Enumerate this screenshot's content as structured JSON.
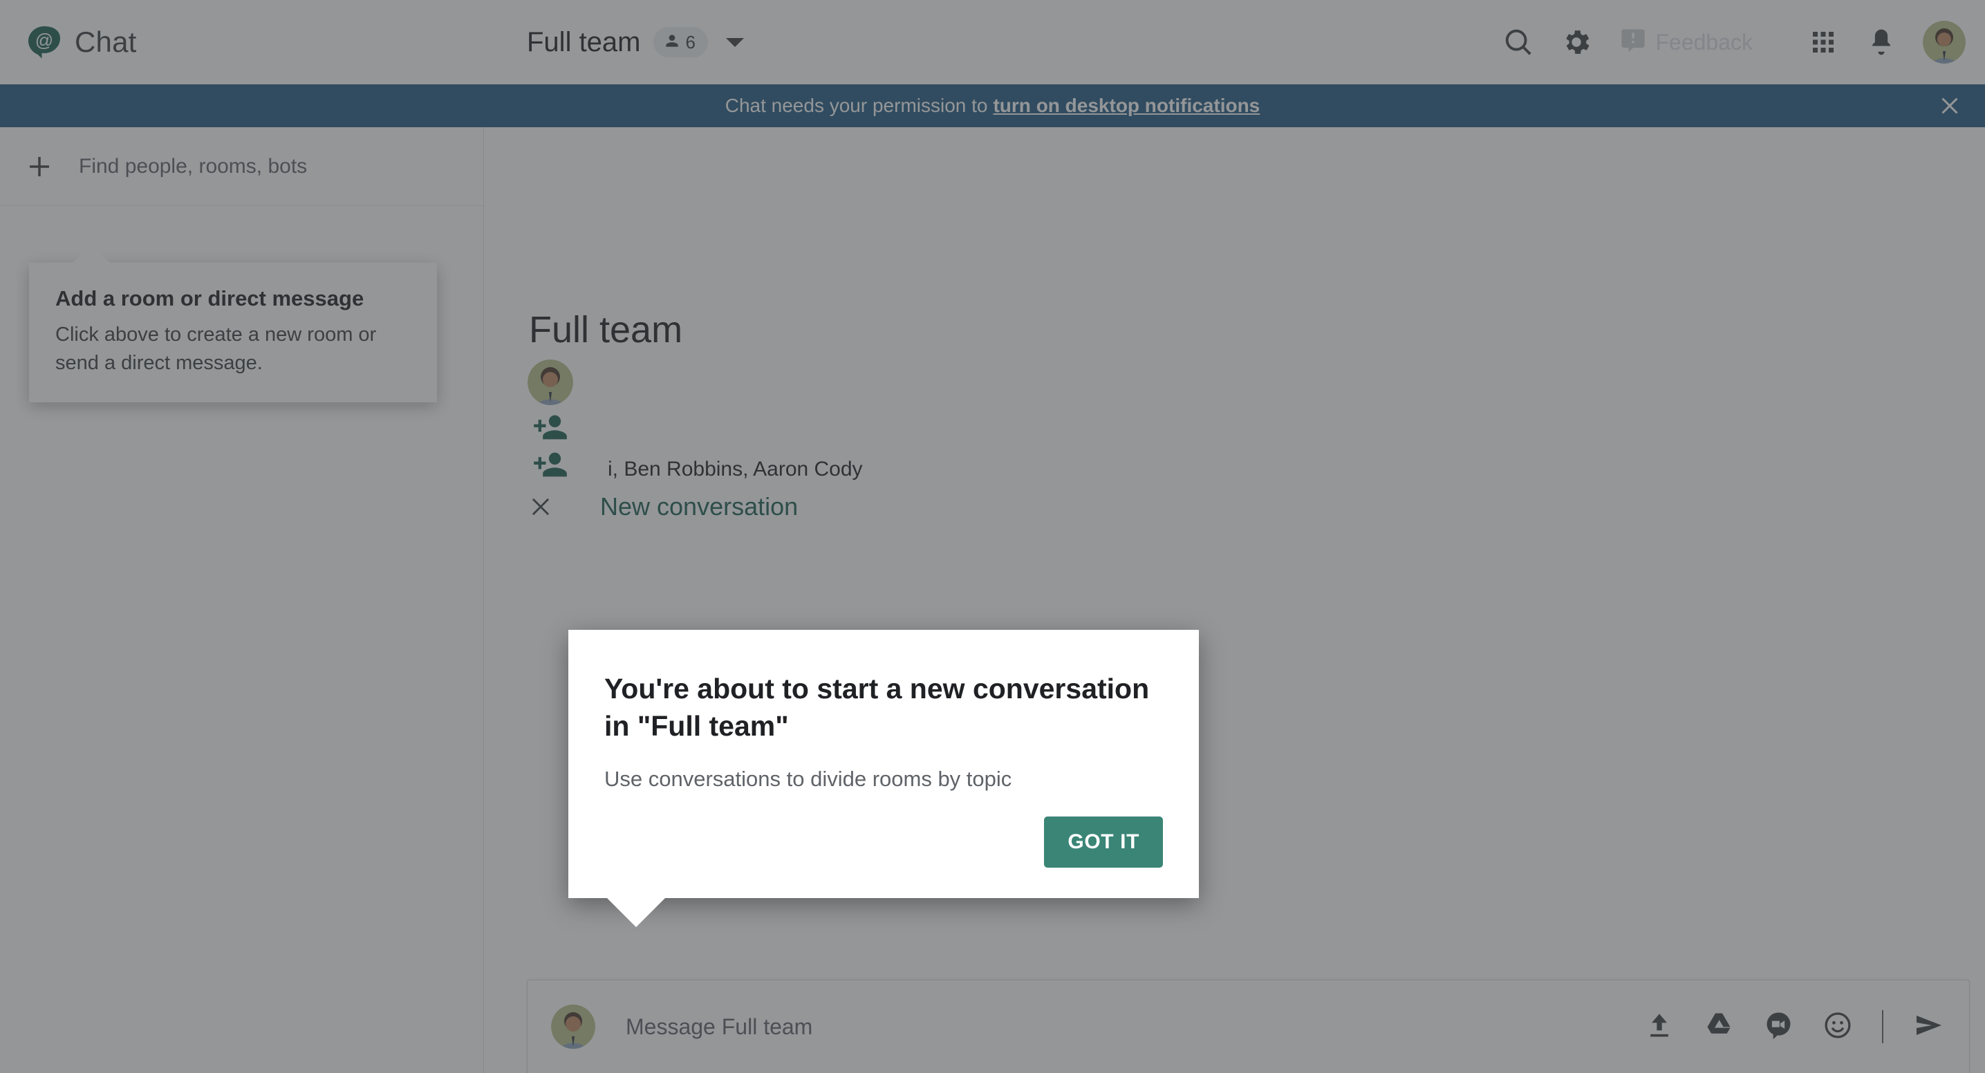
{
  "app": {
    "logo_icon": "chat-at-logo",
    "name": "Chat"
  },
  "header": {
    "room_title": "Full team",
    "member_count": "6",
    "member_icon": "person-icon",
    "dropdown_icon": "chevron-down-icon",
    "search_icon": "search-icon",
    "settings_icon": "gear-icon",
    "feedback_icon": "feedback-icon",
    "feedback_label": "Feedback",
    "apps_icon": "apps-grid-icon",
    "notifications_icon": "bell-icon",
    "avatar_icon": "user-avatar"
  },
  "banner": {
    "text": "Chat needs your permission to",
    "link": "turn on desktop notifications",
    "close_icon": "close-icon",
    "color": "#255b84"
  },
  "sidebar": {
    "add_icon": "plus-icon",
    "find_label": "Find people, rooms, bots",
    "coach": {
      "title": "Add a room or direct message",
      "body": "Click above to create a new room or send a direct message."
    }
  },
  "main": {
    "heading": "Full team",
    "rows": [
      {
        "icon": "user-avatar",
        "text": ""
      },
      {
        "icon": "person-add-icon",
        "text": ""
      },
      {
        "icon": "person-add-icon",
        "text": "i, Ben Robbins, Aaron Cody"
      }
    ],
    "new_conversation": {
      "close_icon": "close-icon",
      "label": "New conversation",
      "color": "#1d6153"
    }
  },
  "compose": {
    "avatar_icon": "user-avatar",
    "placeholder": "Message Full team",
    "actions": [
      {
        "icon": "upload-icon"
      },
      {
        "icon": "google-drive-icon"
      },
      {
        "icon": "video-meet-icon"
      },
      {
        "icon": "emoji-icon"
      },
      {
        "icon": "send-icon"
      }
    ]
  },
  "dialog": {
    "title": "You're about to start a new conversation in \"Full team\"",
    "subtitle": "Use conversations to divide rooms by topic",
    "button_label": "GOT IT",
    "button_color": "#3a8576"
  }
}
